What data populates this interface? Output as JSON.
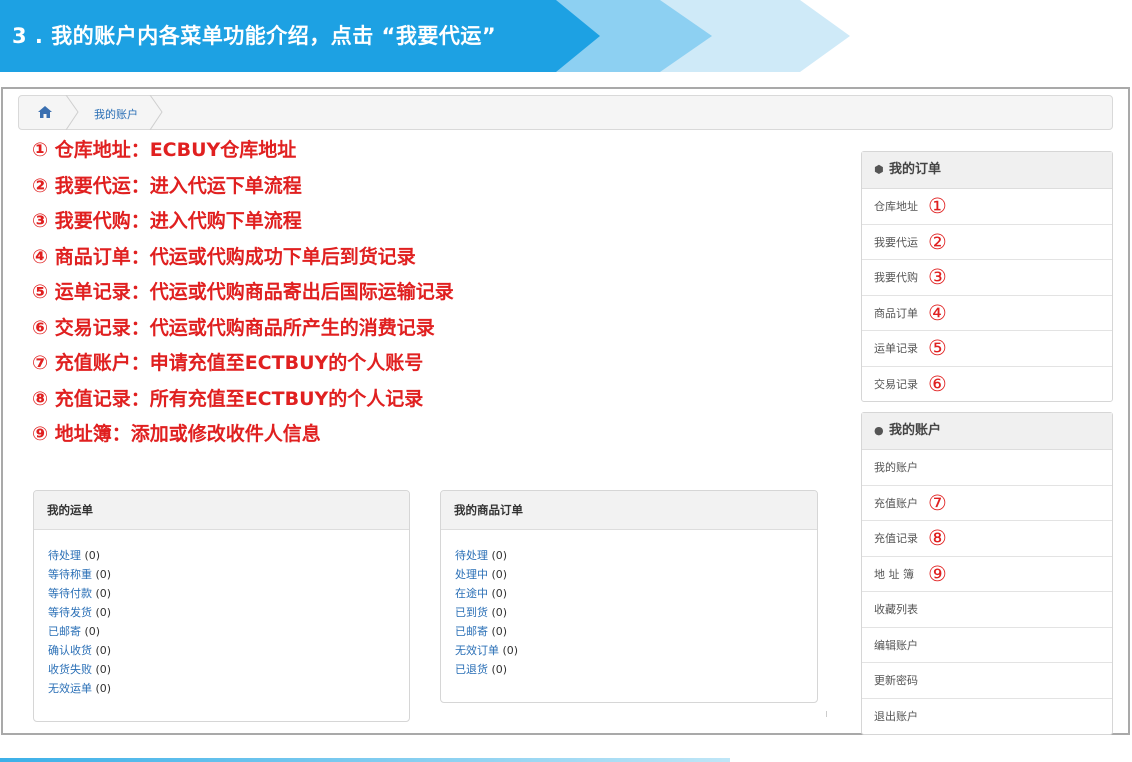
{
  "banner": {
    "title": "3 . 我的账户内各菜单功能介绍，点击 “我要代运”",
    "colors": {
      "dark": "#1da1e3",
      "mid": "#8dd0f2",
      "light": "#cfeaf8"
    }
  },
  "breadcrumb": {
    "home_icon": "home-icon",
    "current": "我的账户"
  },
  "instructions": [
    "① 仓库地址：ECBUY仓库地址",
    "② 我要代运：进入代运下单流程",
    "③ 我要代购：进入代购下单流程",
    "④ 商品订单：代运或代购成功下单后到货记录",
    "⑤ 运单记录：代运或代购商品寄出后国际运输记录",
    "⑥ 交易记录：代运或代购商品所产生的消费记录",
    "⑦ 充值账户：申请充值至ECTBUY的个人账号",
    "⑧ 充值记录：所有充值至ECTBUY的个人记录",
    "⑨ 地址簿：添加或修改收件人信息"
  ],
  "waybill_panel": {
    "title": "我的运单",
    "items": [
      {
        "label": "待处理",
        "count": "(0)"
      },
      {
        "label": "等待称重",
        "count": "(0)"
      },
      {
        "label": "等待付款",
        "count": "(0)"
      },
      {
        "label": "等待发货",
        "count": "(0)"
      },
      {
        "label": "已邮寄",
        "count": "(0)"
      },
      {
        "label": "确认收货",
        "count": "(0)"
      },
      {
        "label": "收货失败",
        "count": "(0)"
      },
      {
        "label": "无效运单",
        "count": "(0)"
      }
    ]
  },
  "orders_panel": {
    "title": "我的商品订单",
    "items": [
      {
        "label": "待处理",
        "count": "(0)"
      },
      {
        "label": "处理中",
        "count": "(0)"
      },
      {
        "label": "在途中",
        "count": "(0)"
      },
      {
        "label": "已到货",
        "count": "(0)"
      },
      {
        "label": "已邮寄",
        "count": "(0)"
      },
      {
        "label": "无效订单",
        "count": "(0)"
      },
      {
        "label": "已退货",
        "count": "(0)"
      }
    ]
  },
  "sidebar": {
    "orders_section": {
      "title": "我的订单",
      "icon": "cube-icon",
      "items": [
        {
          "label": "仓库地址",
          "num": "①"
        },
        {
          "label": "我要代运",
          "num": "②"
        },
        {
          "label": "我要代购",
          "num": "③"
        },
        {
          "label": "商品订单",
          "num": "④"
        },
        {
          "label": "运单记录",
          "num": "⑤"
        },
        {
          "label": "交易记录",
          "num": "⑥"
        }
      ]
    },
    "account_section": {
      "title": "我的账户",
      "icon": "user-icon",
      "items": [
        {
          "label": "我的账户",
          "num": ""
        },
        {
          "label": "充值账户",
          "num": "⑦"
        },
        {
          "label": "充值记录",
          "num": "⑧"
        },
        {
          "label": "地 址 簿",
          "num": "⑨"
        },
        {
          "label": "收藏列表",
          "num": ""
        },
        {
          "label": "编辑账户",
          "num": ""
        },
        {
          "label": "更新密码",
          "num": ""
        },
        {
          "label": "退出账户",
          "num": ""
        }
      ]
    }
  }
}
